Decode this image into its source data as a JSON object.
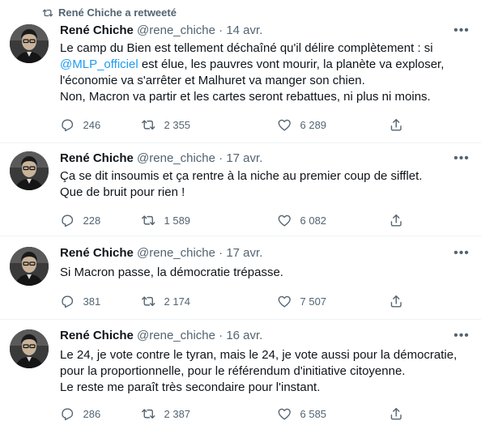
{
  "retweet_banner": "René Chiche a retweeté",
  "icons": {
    "retweet": "retweet-icon",
    "reply": "reply-icon",
    "like": "heart-icon",
    "share": "share-icon",
    "more": "more-icon"
  },
  "colors": {
    "mention": "#1d9bf0",
    "muted": "#536471",
    "text": "#0f1419"
  },
  "tweets": [
    {
      "name": "René Chiche",
      "handle": "@rene_chiche",
      "dot": "·",
      "date": "14 avr.",
      "text_l1": "Le camp du Bien est tellement déchaîné qu'il délire complètement : si",
      "mention": "@MLP_officiel",
      "text_l2_after": " est élue, les pauvres vont mourir, la planète va exploser,",
      "text_l3": "l'économie va s'arrêter et Malhuret va manger son chien.",
      "text_l4": "Non, Macron va partir et les cartes seront rebattues, ni plus ni moins.",
      "replies": "246",
      "retweets": "2 355",
      "likes": "6 289"
    },
    {
      "name": "René Chiche",
      "handle": "@rene_chiche",
      "dot": "·",
      "date": "17 avr.",
      "text_l1": "Ça se dit insoumis et ça rentre à la niche au premier coup de sifflet.",
      "text_l2": "Que de bruit pour rien !",
      "replies": "228",
      "retweets": "1 589",
      "likes": "6 082"
    },
    {
      "name": "René Chiche",
      "handle": "@rene_chiche",
      "dot": "·",
      "date": "17 avr.",
      "text_l1": "Si Macron passe, la démocratie trépasse.",
      "replies": "381",
      "retweets": "2 174",
      "likes": "7 507"
    },
    {
      "name": "René Chiche",
      "handle": "@rene_chiche",
      "dot": "·",
      "date": "16 avr.",
      "text_l1": "Le 24, je vote contre le tyran, mais le 24, je vote aussi pour la démocratie,",
      "text_l2": "pour la proportionnelle, pour le référendum d'initiative citoyenne.",
      "text_l3": "Le reste me paraît très secondaire pour l'instant.",
      "replies": "286",
      "retweets": "2 387",
      "likes": "6 585"
    }
  ]
}
